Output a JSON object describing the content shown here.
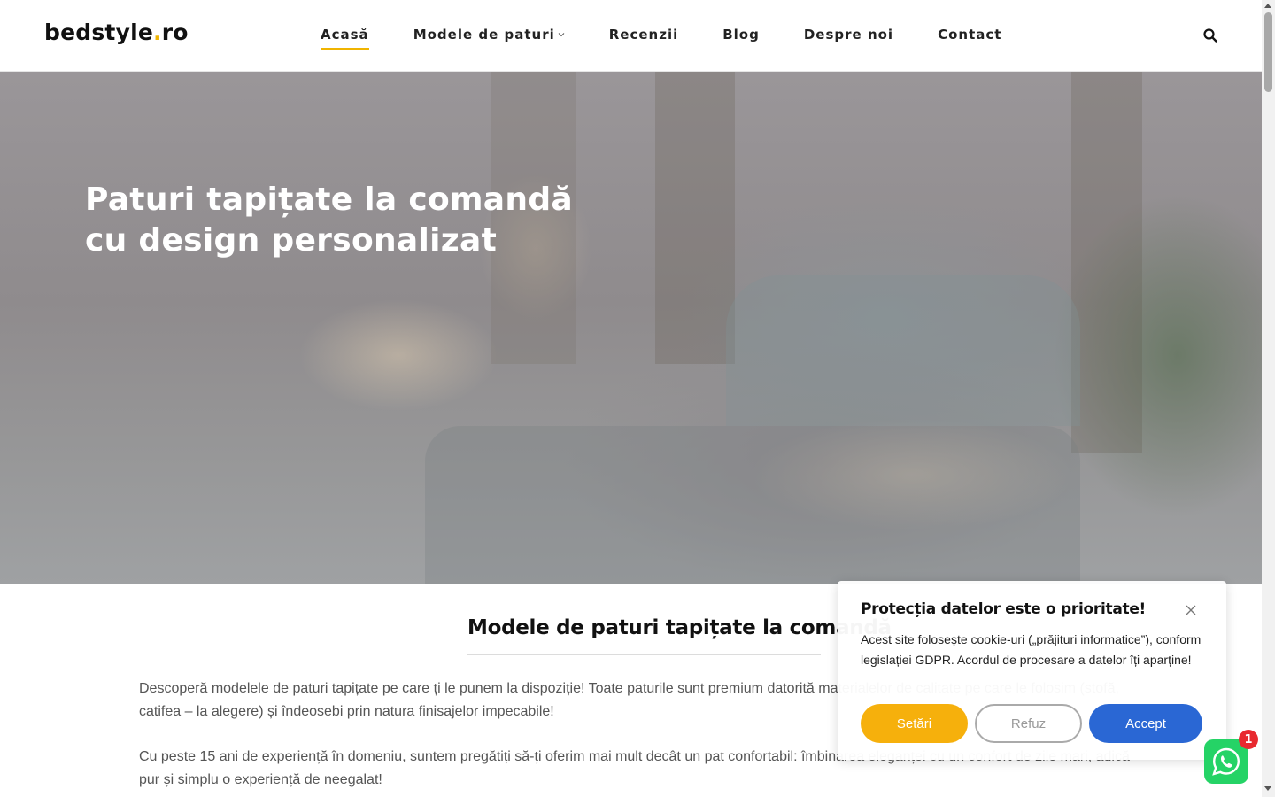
{
  "header": {
    "logo_main": "bedstyle",
    "logo_dot": ".",
    "logo_tld": "ro",
    "nav": [
      {
        "label": "Acasă",
        "active": true
      },
      {
        "label": "Modele de paturi",
        "has_dropdown": true
      },
      {
        "label": "Recenzii"
      },
      {
        "label": "Blog"
      },
      {
        "label": "Despre noi"
      },
      {
        "label": "Contact"
      }
    ],
    "search_icon": "search-icon",
    "accent_color": "#f0b400"
  },
  "hero": {
    "title_line1": "Paturi tapițate la comandă",
    "title_line2": "cu design personalizat"
  },
  "content": {
    "section_title": "Modele de paturi tapițate la comandă",
    "paragraph1": "Descoperă modelele de paturi tapițate pe care ți le punem la dispoziție! Toate paturile sunt premium datorită materialelor de calitate pe care le folosim (stofă, catifea – la alegere) și îndeosebi prin natura finisajelor impecabile!",
    "paragraph2": "Cu peste 15 ani de experiență în domeniu, suntem pregătiți să-ți oferim mai mult decât un pat confortabil: îmbinarea eleganței cu un confort de zile mari, adică pur și simplu o experiență de neegalat!"
  },
  "cookie": {
    "title": "Protecția datelor este o prioritate!",
    "text": "Acest site folosește cookie-uri („prăjituri informatice”), conform legislației GDPR. Acordul de procesare a datelor îți aparține!",
    "settings_label": "Setări",
    "refuse_label": "Refuz",
    "accept_label": "Accept",
    "settings_color": "#f6b00c",
    "accept_color": "#2a67d4"
  },
  "whatsapp": {
    "badge_count": "1",
    "icon": "whatsapp-icon",
    "color": "#25d366"
  }
}
